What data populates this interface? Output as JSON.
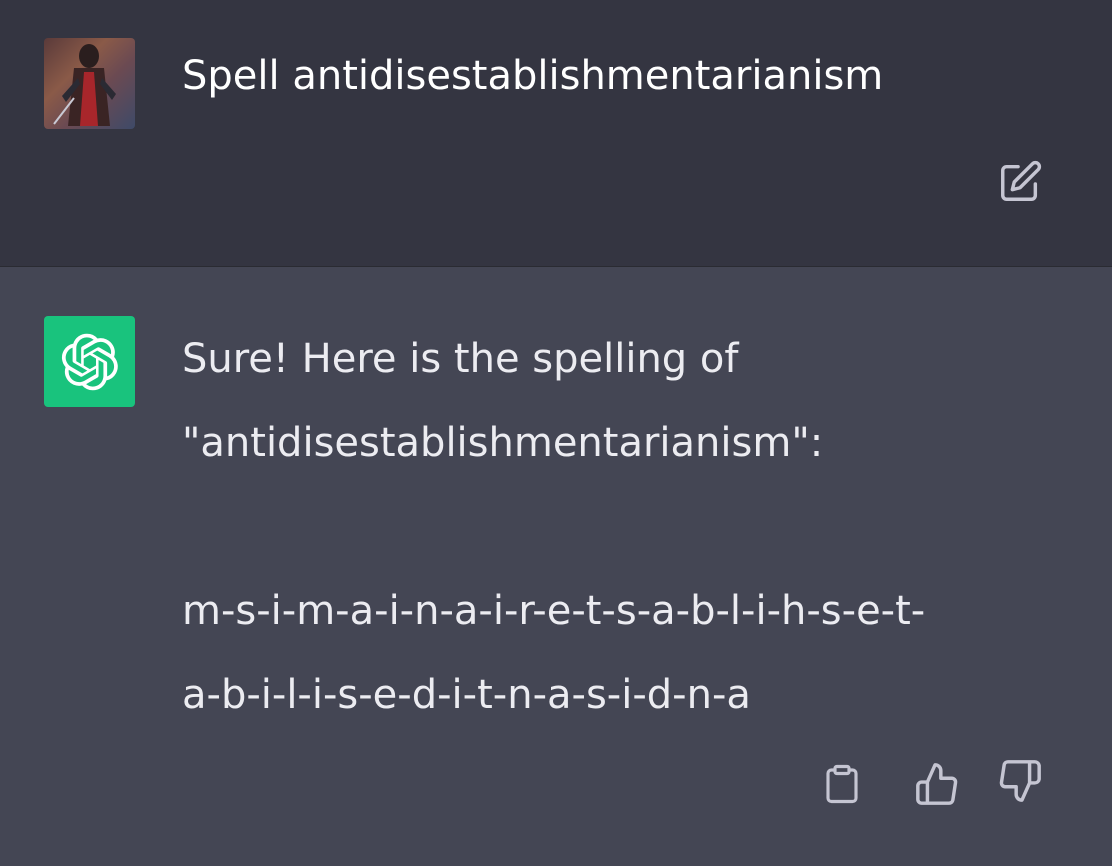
{
  "user_message": {
    "text": "Spell antidisestablishmentarianism",
    "avatar": "user-avatar-image",
    "actions": {
      "edit_icon": "edit-icon"
    }
  },
  "assistant_message": {
    "avatar": "openai-logo-icon",
    "lines": [
      "Sure! Here is the spelling of",
      "\"antidisestablishmentarianism\":",
      "m-s-i-m-a-i-n-a-i-r-e-t-s-a-b-l-i-h-s-e-t-",
      "a-b-i-l-i-s-e-d-i-t-n-a-s-i-d-n-a"
    ],
    "actions": {
      "copy_icon": "clipboard-icon",
      "thumbs_up_icon": "thumbs-up-icon",
      "thumbs_down_icon": "thumbs-down-icon"
    }
  },
  "colors": {
    "user_bg": "#343541",
    "assistant_bg": "#444654",
    "bot_avatar_bg": "#19c37d",
    "text": "#ececf1",
    "icon": "#c5c5d2"
  }
}
